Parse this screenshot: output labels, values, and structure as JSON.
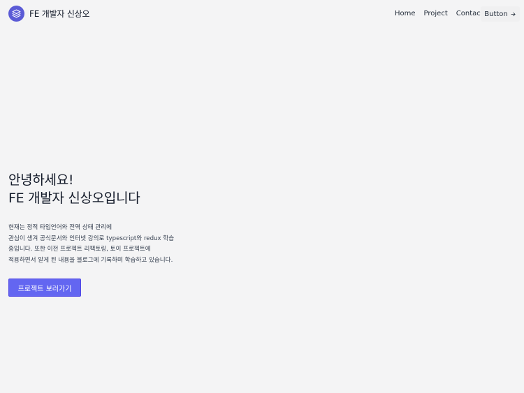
{
  "header": {
    "brand": "FE 개발자 신상오",
    "logo_icon": "stack-layers-icon",
    "nav": [
      "Home",
      "Project",
      "Contact"
    ],
    "button_label": "Button",
    "button_icon": "arrow-right-icon"
  },
  "hero": {
    "title_line1": "안녕하세요!",
    "title_line2": "FE 개발자 신상오입니다",
    "desc_lines": [
      "현재는 정적 타입언어와 전역 상태 관리에",
      "관심이 생겨 공식문서와 인터넷 강의로 typescript와 redux 학습",
      "중입니다. 또한 이전 프로젝트 리팩토링, 토이 프로젝트에",
      "적용하면서 알게 된 내용을 블로그에 기록하며 학습하고 있습니다."
    ],
    "cta_label": "프로젝트 보러가기"
  },
  "colors": {
    "background": "#f4f4f5",
    "accent": "#6366f1",
    "logo_bg": "#5b5bd6",
    "text": "#111827"
  }
}
